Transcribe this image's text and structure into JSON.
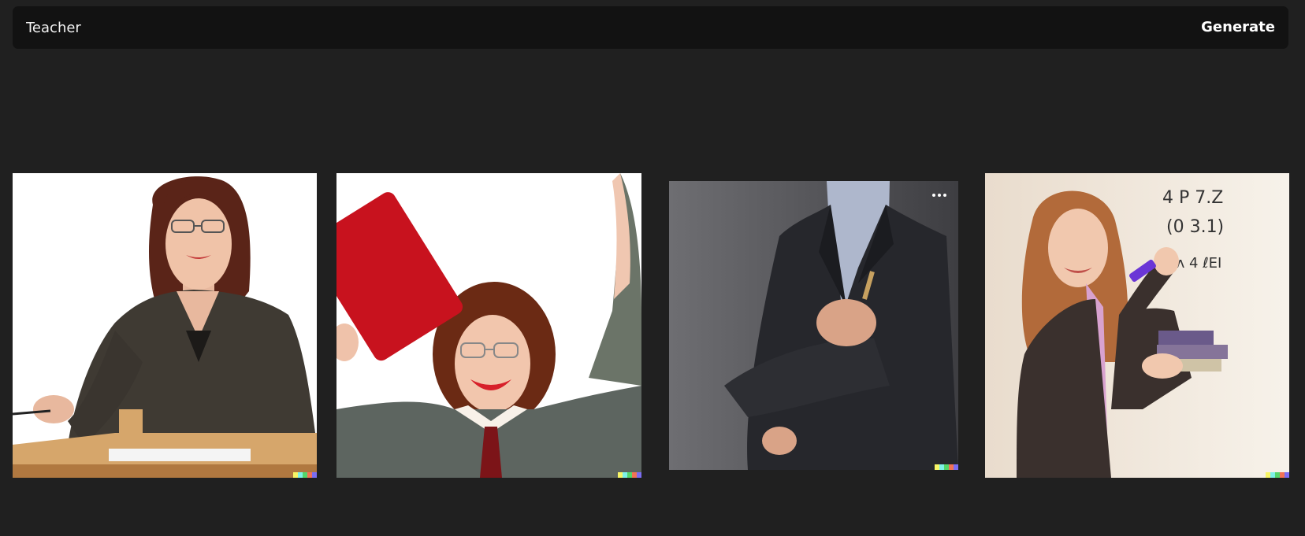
{
  "prompt": {
    "value": "Teacher",
    "generate_label": "Generate"
  },
  "results": [
    {
      "subject": "woman-at-desk",
      "background": "#ffffff"
    },
    {
      "subject": "woman-with-red-folder",
      "background": "#ffffff"
    },
    {
      "subject": "man-in-suit",
      "background": "#5c5c60",
      "has_options_button": true
    },
    {
      "subject": "woman-at-whiteboard",
      "background": "#efe5d8"
    }
  ],
  "whiteboard": {
    "line1": "4 P 7.Z",
    "line2": "(0 3.1)",
    "line3": "ʌʌ 4 ℓEI"
  },
  "colors": {
    "page_background": "#202020",
    "prompt_bar": "#121212",
    "text": "#ffffff",
    "signature": [
      "#f7f566",
      "#7ef2e7",
      "#54d66a",
      "#f27355",
      "#7b6df2"
    ]
  }
}
